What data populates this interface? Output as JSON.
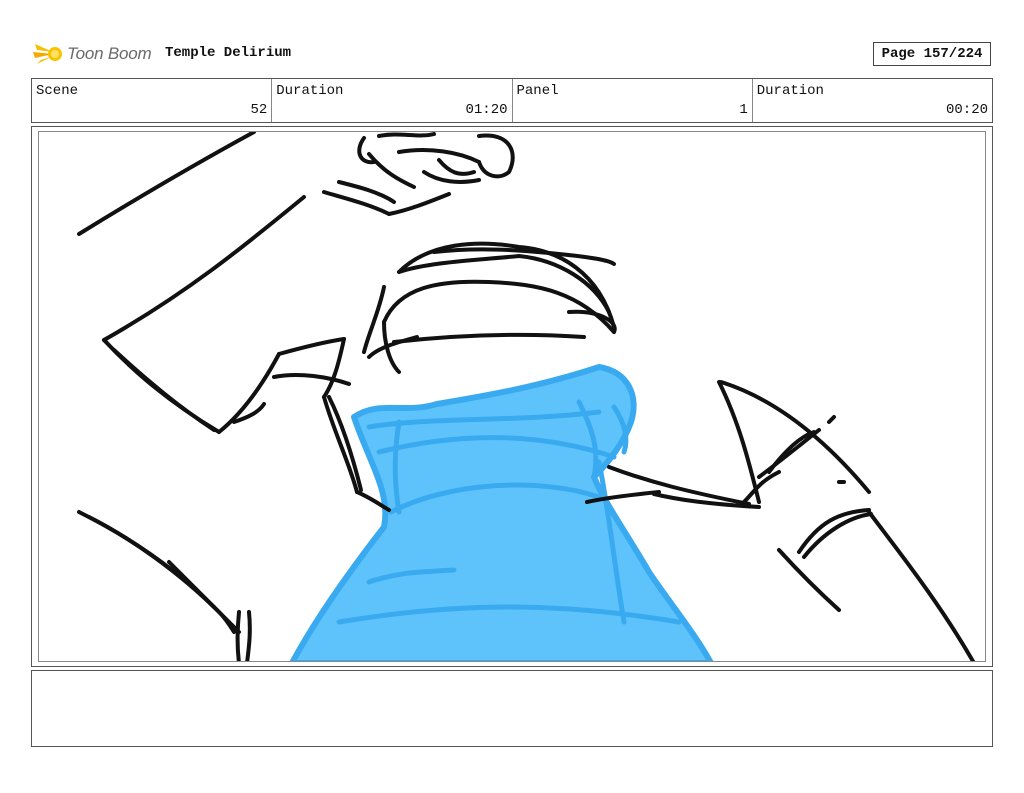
{
  "header": {
    "brand": "Toon Boom",
    "logo_icon": "sun-star-icon",
    "project_title": "Temple Delirium",
    "page_label": "Page 157/224"
  },
  "info": {
    "scene_label": "Scene",
    "scene_value": "52",
    "scene_duration_label": "Duration",
    "scene_duration_value": "01:20",
    "panel_label": "Panel",
    "panel_value": "1",
    "panel_duration_label": "Duration",
    "panel_duration_value": "00:20"
  },
  "colors": {
    "sketch_stroke": "#111111",
    "fill_blue": "#5fc3fb",
    "fill_blue_stroke": "#3aaaf0",
    "logo_yellow": "#f5c000"
  },
  "notes": {
    "text": ""
  }
}
